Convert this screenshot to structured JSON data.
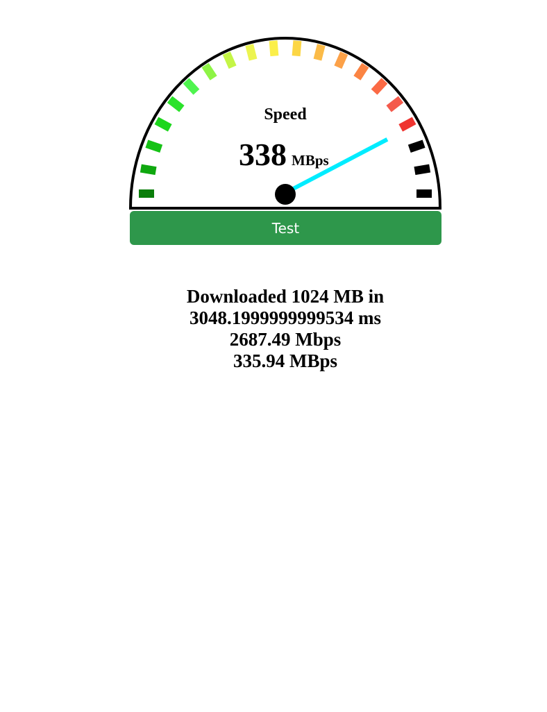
{
  "gauge": {
    "title": "Speed",
    "value": "338",
    "unit": "MBps",
    "value_number": 338,
    "needle_fraction": 0.846,
    "colors": {
      "arc": "#000000",
      "needle": "#00ecff",
      "hub": "#000000",
      "ticks": [
        "#0a7e0a",
        "#0fa80f",
        "#16c216",
        "#1ed61e",
        "#2be22b",
        "#4ff44f",
        "#8ef446",
        "#c4f546",
        "#ecf450",
        "#fbef4a",
        "#fcd645",
        "#fbbb48",
        "#fca148",
        "#fb8443",
        "#fb6a45",
        "#f45a4c",
        "#ef3430",
        "#000000",
        "#000000",
        "#000000"
      ]
    }
  },
  "test_button": {
    "label": "Test"
  },
  "results": {
    "line1": "Downloaded 1024 MB in",
    "line2": "3048.1999999999534 ms",
    "line3": "2687.49 Mbps",
    "line4": "335.94 MBps"
  }
}
